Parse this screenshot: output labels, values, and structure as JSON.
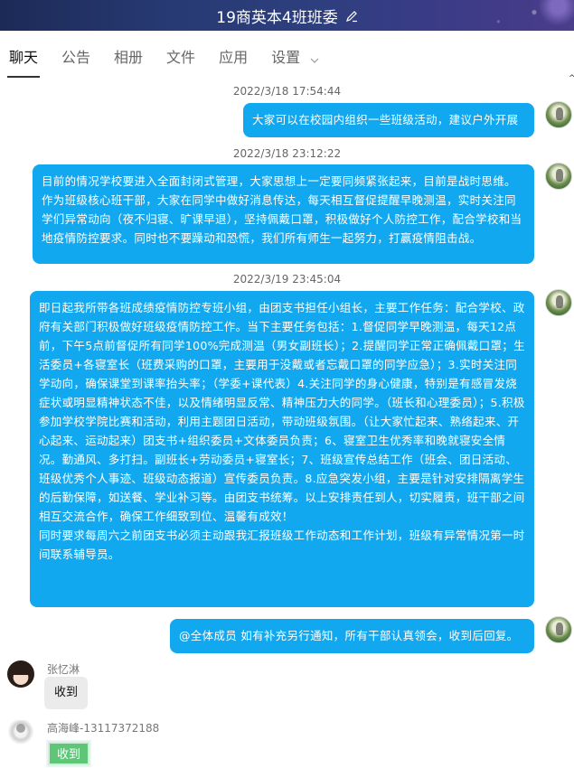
{
  "header": {
    "title": "19商英本4班班委",
    "edit_icon": "edit-icon"
  },
  "tabs": [
    {
      "label": "聊天"
    },
    {
      "label": "公告"
    },
    {
      "label": "相册"
    },
    {
      "label": "文件"
    },
    {
      "label": "应用"
    },
    {
      "label": "设置"
    }
  ],
  "messages": [
    {
      "timestamp": "2022/3/18 17:54:44",
      "text": "大家可以在校园内组织一些班级活动，建议户外开展"
    },
    {
      "timestamp": "2022/3/18 23:12:22",
      "text": "目前的情况学校要进入全面封闭式管理，大家思想上一定要同频紧张起来，目前是战时思维。作为班级核心班干部，大家在同学中做好消息传达，每天相互督促提醒早晚测温，实时关注同学们异常动向（夜不归寝、旷课早退），坚持佩戴口罩，积极做好个人防控工作，配合学校和当地疫情防控要求。同时也不要躁动和恐慌，我们所有师生一起努力，打赢疫情阻击战。"
    },
    {
      "timestamp": "2022/3/19 23:45:04",
      "text": "即日起我所带各班成绩疫情防控专班小组，由团支书担任小组长，主要工作任务：配合学校、政府有关部门积极做好班级疫情防控工作。当下主要任务包括：1.督促同学早晚测温，每天12点前，下午5点前督促所有同学100%完成测温（男女副班长）；2.提醒同学正常正确佩戴口罩；生活委员+各寝室长（班费采购的口罩，主要用于没戴或者忘戴口罩的同学应急）；3.实时关注同学动向，确保课堂到课率抬头率；（学委+课代表）4.关注同学的身心健康，特别是有感冒发烧症状或明显精神状态不佳，以及情绪明显反常、精神压力大的同学。（班长和心理委员）；5.积极参加学校学院比赛和活动，利用主题团日活动，带动班级氛围。（让大家忙起来、熟络起来、开心起来、运动起来）团支书+组织委员+文体委员负责；6、寝室卫生优秀率和晚就寝安全情况。勤通风、多打扫。副班长+劳动委员+寝室长；7、班级宣传总结工作（班会、团日活动、班级优秀个人事迹、班级动态报道）宣传委员负责。8.应急突发小组，主要是针对安排隔离学生的后勤保障，如送餐、学业补习等。由团支书统筹。以上安排责任到人，切实履责，班干部之间相互交流合作，确保工作细致到位、温馨有成效！",
      "text2": "同时要求每周六之前团支书必须主动跟我汇报班级工作动态和工作计划，班级有异常情况第一时间联系辅导员。"
    },
    {
      "text": "@全体成员 如有补充另行通知，所有干部认真领会，收到后回复。"
    },
    {
      "sender": "张忆淋",
      "text": "收到"
    },
    {
      "sender": "高海峰-13117372188",
      "text": "收到"
    }
  ],
  "corner_mark": "^",
  "colors": {
    "bubble_blue": "#12a8ef",
    "header_bg": "#273a73",
    "bubble_gray": "#ebebeb",
    "bubble_green": "#5fc678"
  }
}
